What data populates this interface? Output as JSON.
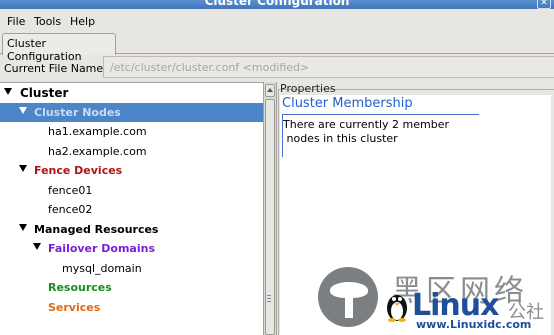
{
  "window": {
    "title": "Cluster Configuration",
    "close_glyph": "✕"
  },
  "menu": [
    "File",
    "Tools",
    "Help"
  ],
  "tab": {
    "label": "Cluster Configuration"
  },
  "file": {
    "label": "Current File Name:",
    "value": "/etc/cluster/cluster.conf <modified>"
  },
  "tree": {
    "root": "Cluster",
    "nodes_label": "Cluster Nodes",
    "nodes": [
      "ha1.example.com",
      "ha2.example.com"
    ],
    "fence_label": "Fence Devices",
    "fences": [
      "fence01",
      "fence02"
    ],
    "managed_label": "Managed Resources",
    "failover_label": "Failover Domains",
    "domains": [
      "mysql_domain"
    ],
    "resources_label": "Resources",
    "services_label": "Services"
  },
  "properties": {
    "frame_label": "Properties",
    "heading": "Cluster Membership",
    "text_line1": "There are currently 2 member",
    "text_line2": " nodes in this cluster"
  },
  "colors": {
    "selection": "#4c86c8",
    "fence": "#b01414",
    "failover": "#7a1fd6",
    "resources": "#1c8c1c",
    "services": "#e06a10",
    "heading": "#1f5fcf"
  },
  "watermark": {
    "chinese": "黑区网络",
    "brand": "Linux",
    "she": "公社",
    "url": "www.Linuxidc.com"
  }
}
